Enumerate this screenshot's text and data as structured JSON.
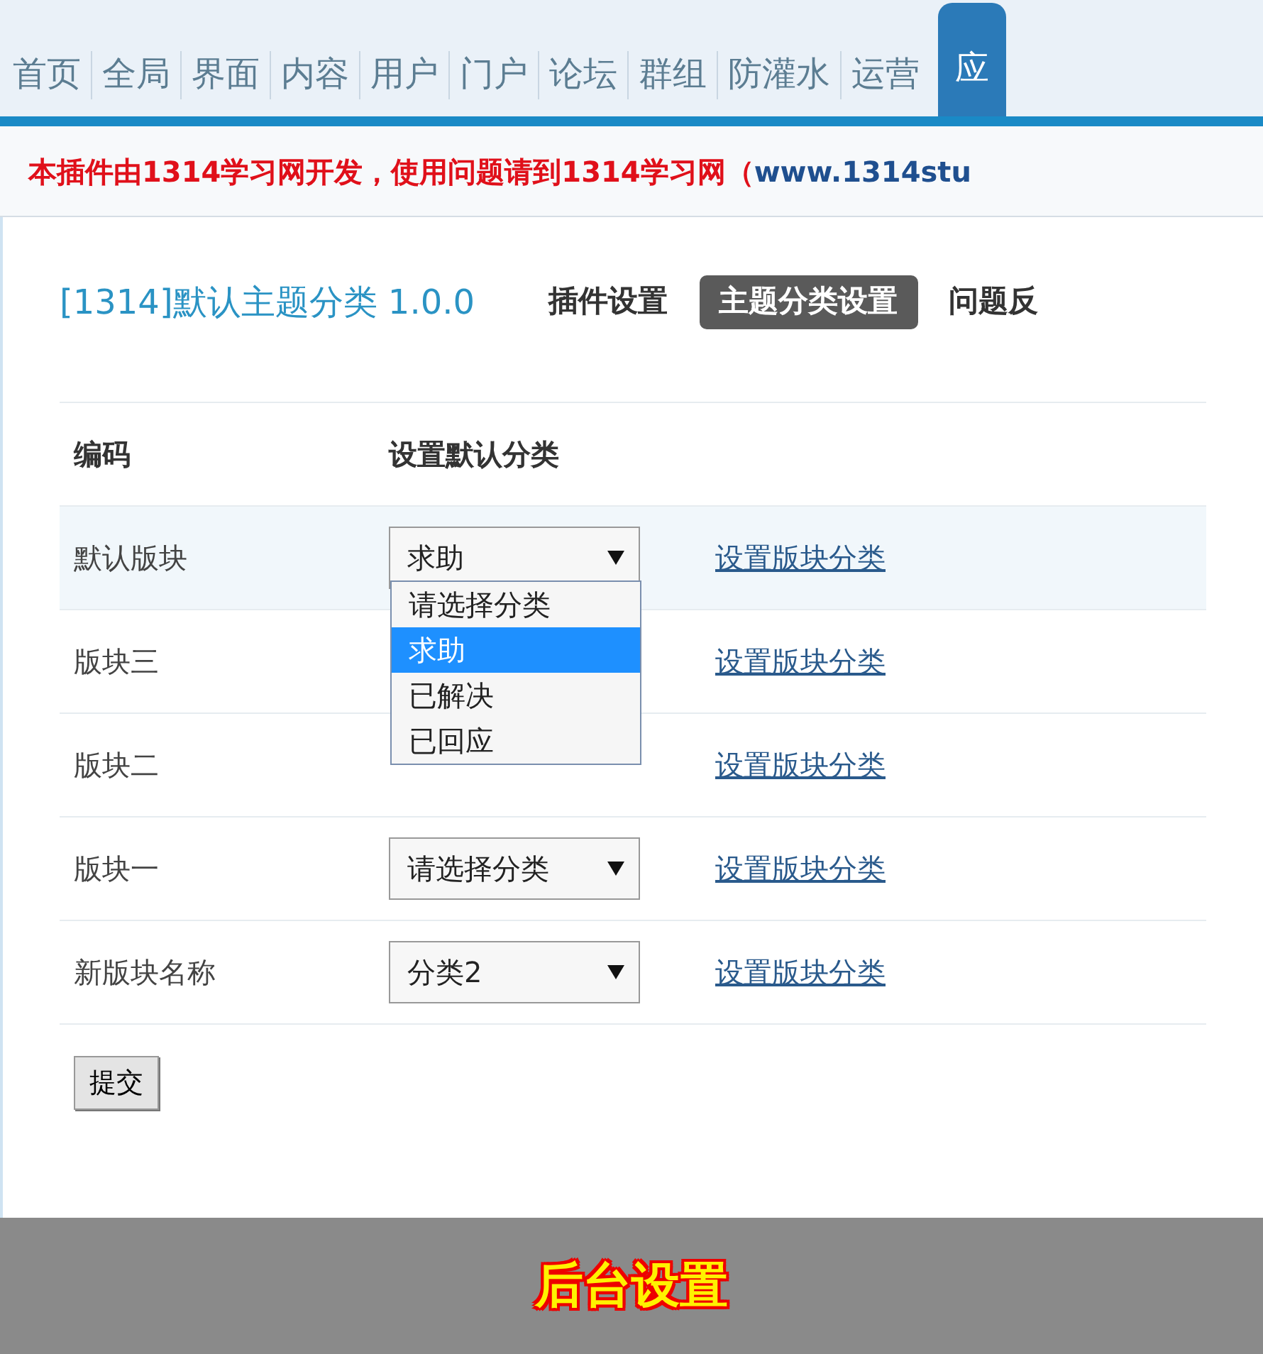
{
  "nav_tabs": [
    {
      "label": "首页",
      "selected": false
    },
    {
      "label": "全局",
      "selected": false
    },
    {
      "label": "界面",
      "selected": false
    },
    {
      "label": "内容",
      "selected": false
    },
    {
      "label": "用户",
      "selected": false
    },
    {
      "label": "门户",
      "selected": false
    },
    {
      "label": "论坛",
      "selected": false
    },
    {
      "label": "群组",
      "selected": false
    },
    {
      "label": "防灌水",
      "selected": false
    },
    {
      "label": "运营",
      "selected": false
    },
    {
      "label": "应",
      "selected": true
    }
  ],
  "notice": [
    {
      "kind": "plain",
      "text": "本插件由1314学习网开发，使用问题请到1314学习网（"
    },
    {
      "kind": "link",
      "text": "www.1314stu"
    }
  ],
  "plugin": {
    "title": "[1314]默认主题分类 1.0.0",
    "tabs": [
      {
        "label": "插件设置",
        "selected": false
      },
      {
        "label": "主题分类设置",
        "selected": true
      },
      {
        "label": "问题反",
        "selected": false
      }
    ]
  },
  "table": {
    "columns": [
      "编码",
      "设置默认分类"
    ],
    "rows": [
      {
        "name": "默认版块",
        "select": "求助",
        "link": "设置版块分类",
        "highlighted": true
      },
      {
        "name": "版块三",
        "link": "设置版块分类",
        "highlighted": false
      },
      {
        "name": "版块二",
        "link": "设置版块分类",
        "highlighted": false
      },
      {
        "name": "版块一",
        "select": "请选择分类",
        "link": "设置版块分类",
        "highlighted": false
      },
      {
        "name": "新版块名称",
        "select": "分类2",
        "link": "设置版块分类",
        "highlighted": false
      }
    ]
  },
  "dropdown": {
    "options": [
      {
        "label": "请选择分类",
        "selected": false
      },
      {
        "label": "求助",
        "selected": true
      },
      {
        "label": "已解决",
        "selected": false
      },
      {
        "label": "已回应",
        "selected": false
      }
    ]
  },
  "submit_button": "提交",
  "caption": "后台设置"
}
